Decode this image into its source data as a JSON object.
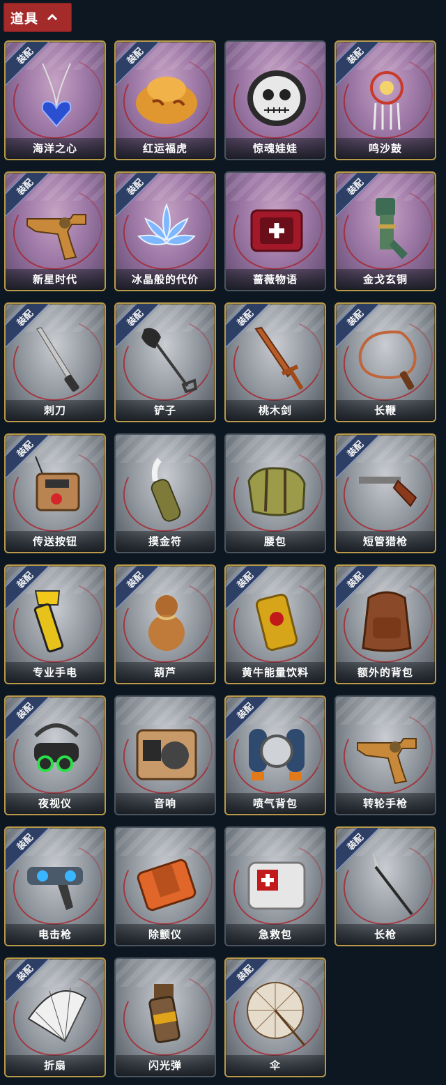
{
  "header": {
    "title": "道具"
  },
  "equip_text": "装配",
  "items": [
    {
      "name": "海洋之心",
      "equipped": true,
      "rarity": "purple",
      "icon": "heart-necklace-icon"
    },
    {
      "name": "红运福虎",
      "equipped": true,
      "rarity": "purple",
      "icon": "lucky-tiger-icon"
    },
    {
      "name": "惊魂娃娃",
      "equipped": false,
      "rarity": "purple",
      "icon": "skull-doll-icon"
    },
    {
      "name": "鸣沙鼓",
      "equipped": true,
      "rarity": "purple",
      "icon": "dreamcatcher-drum-icon"
    },
    {
      "name": "新星时代",
      "equipped": true,
      "rarity": "purple",
      "icon": "revolver-icon"
    },
    {
      "name": "冰晶般的代价",
      "equipped": true,
      "rarity": "purple",
      "icon": "ice-lotus-icon"
    },
    {
      "name": "蔷薇物语",
      "equipped": false,
      "rarity": "purple",
      "icon": "medkit-box-icon"
    },
    {
      "name": "金戈玄铜",
      "equipped": true,
      "rarity": "purple",
      "icon": "bronze-device-icon"
    },
    {
      "name": "刺刀",
      "equipped": true,
      "rarity": "grey",
      "icon": "bayonet-icon"
    },
    {
      "name": "铲子",
      "equipped": true,
      "rarity": "grey",
      "icon": "shovel-icon"
    },
    {
      "name": "桃木剑",
      "equipped": true,
      "rarity": "grey",
      "icon": "wooden-sword-icon"
    },
    {
      "name": "长鞭",
      "equipped": true,
      "rarity": "grey",
      "icon": "whip-icon"
    },
    {
      "name": "传送按钮",
      "equipped": true,
      "rarity": "grey",
      "icon": "teleport-remote-icon"
    },
    {
      "name": "摸金符",
      "equipped": false,
      "rarity": "grey",
      "icon": "talisman-icon"
    },
    {
      "name": "腰包",
      "equipped": false,
      "rarity": "grey",
      "icon": "waist-bag-icon"
    },
    {
      "name": "短管猎枪",
      "equipped": true,
      "rarity": "grey",
      "icon": "shotgun-icon"
    },
    {
      "name": "专业手电",
      "equipped": true,
      "rarity": "grey",
      "icon": "flashlight-icon"
    },
    {
      "name": "葫芦",
      "equipped": true,
      "rarity": "grey",
      "icon": "gourd-icon"
    },
    {
      "name": "黄牛能量饮料",
      "equipped": true,
      "rarity": "grey",
      "icon": "energy-can-icon"
    },
    {
      "name": "额外的背包",
      "equipped": true,
      "rarity": "grey",
      "icon": "backpack-icon"
    },
    {
      "name": "夜视仪",
      "equipped": true,
      "rarity": "grey",
      "icon": "night-vision-icon"
    },
    {
      "name": "音响",
      "equipped": false,
      "rarity": "grey",
      "icon": "radio-icon"
    },
    {
      "name": "喷气背包",
      "equipped": true,
      "rarity": "grey",
      "icon": "jetpack-icon"
    },
    {
      "name": "转轮手枪",
      "equipped": false,
      "rarity": "grey",
      "icon": "revolver-icon"
    },
    {
      "name": "电击枪",
      "equipped": true,
      "rarity": "grey",
      "icon": "shock-gun-icon"
    },
    {
      "name": "除颤仪",
      "equipped": false,
      "rarity": "grey",
      "icon": "defibrillator-icon"
    },
    {
      "name": "急救包",
      "equipped": false,
      "rarity": "grey",
      "icon": "first-aid-kit-icon"
    },
    {
      "name": "长枪",
      "equipped": true,
      "rarity": "grey",
      "icon": "spear-icon"
    },
    {
      "name": "折扇",
      "equipped": true,
      "rarity": "grey",
      "icon": "folding-fan-icon"
    },
    {
      "name": "闪光弹",
      "equipped": false,
      "rarity": "grey",
      "icon": "flashbang-icon"
    },
    {
      "name": "伞",
      "equipped": true,
      "rarity": "grey",
      "icon": "umbrella-icon"
    }
  ]
}
